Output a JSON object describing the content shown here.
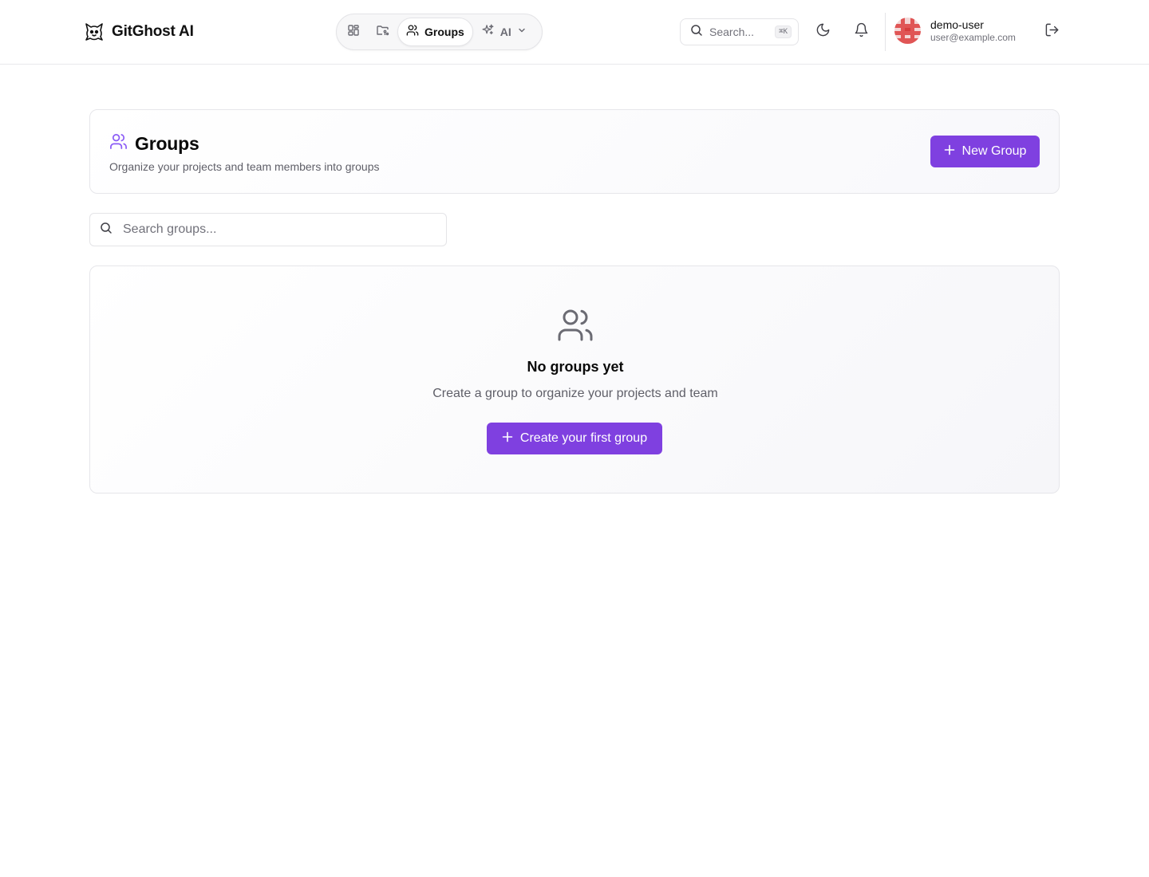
{
  "brand": {
    "name": "GitGhost AI"
  },
  "nav": {
    "items": [
      {
        "icon": "dashboard-grid-icon",
        "label": ""
      },
      {
        "icon": "folder-git-icon",
        "label": ""
      },
      {
        "icon": "users-icon",
        "label": "Groups",
        "active": true
      },
      {
        "icon": "sparkles-icon",
        "label": "AI",
        "dropdown": true
      }
    ]
  },
  "header": {
    "search_placeholder": "Search...",
    "search_shortcut": "⌘K"
  },
  "user": {
    "name": "demo-user",
    "email": "user@example.com"
  },
  "page": {
    "title": "Groups",
    "subtitle": "Organize your projects and team members into groups",
    "new_button_label": "New Group"
  },
  "search_groups": {
    "placeholder": "Search groups..."
  },
  "empty_state": {
    "title": "No groups yet",
    "subtitle": "Create a group to organize your projects and team",
    "button_label": "Create your first group"
  },
  "colors": {
    "accent": "#7f40e0",
    "accent_icon": "#8b5cf6",
    "border": "#e4e4e7",
    "muted_text": "#71717a"
  }
}
